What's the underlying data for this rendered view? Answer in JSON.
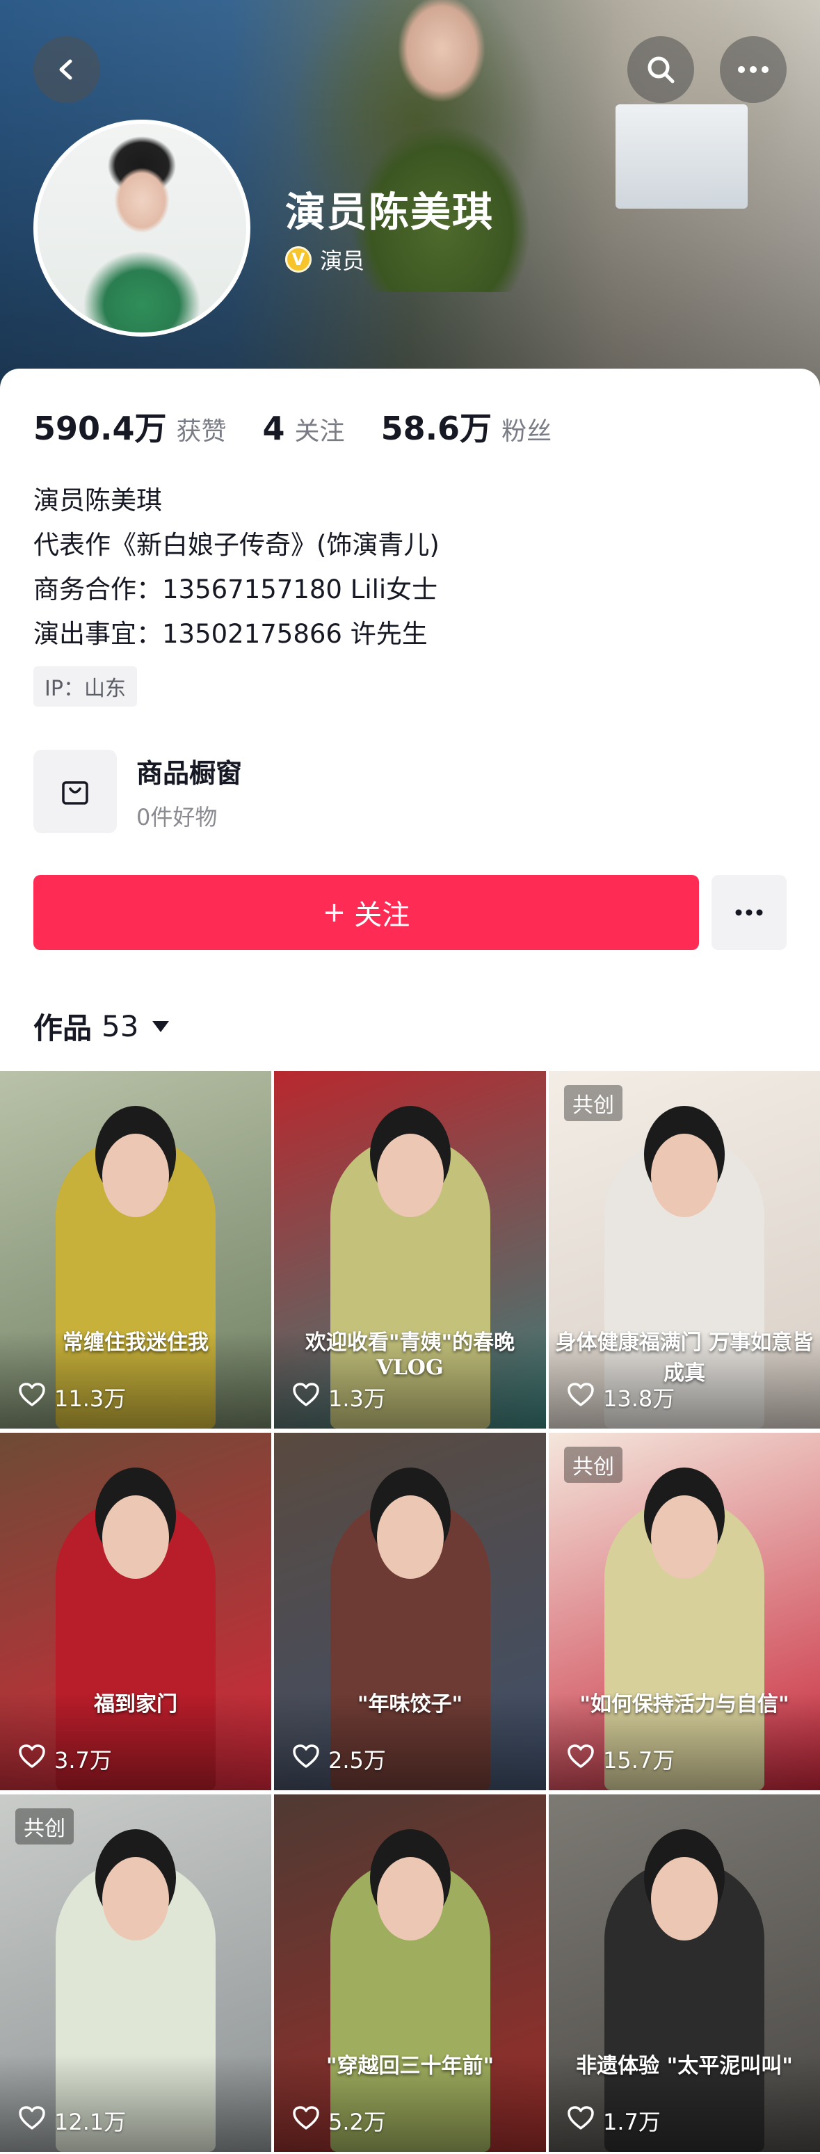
{
  "header": {
    "name": "演员陈美琪",
    "verified_badge": "V",
    "verified_label": "演员"
  },
  "stats": [
    {
      "value": "590.4万",
      "label": "获赞"
    },
    {
      "value": "4",
      "label": "关注"
    },
    {
      "value": "58.6万",
      "label": "粉丝"
    }
  ],
  "bio": {
    "lines": [
      "演员陈美琪",
      "代表作《新白娘子传奇》(饰演青儿)",
      "商务合作：13567157180 Lili女士",
      "演出事宜：13502175866 许先生"
    ],
    "ip": "IP：山东"
  },
  "shop": {
    "title": "商品橱窗",
    "subtitle": "0件好物"
  },
  "follow": {
    "label": "关注",
    "plus": "+"
  },
  "works": {
    "title": "作品",
    "count": "53"
  },
  "videos": [
    {
      "likes": "11.3万",
      "badge": "",
      "caption": "常缠住我迷住我",
      "colors": [
        "#b9c2a8",
        "#6f7f62"
      ],
      "outfit": "#c7b13a"
    },
    {
      "likes": "1.3万",
      "badge": "",
      "caption": "欢迎收看\"青姨\"的春晚VLOG",
      "colors": [
        "#b8282e",
        "#3a7f7a"
      ],
      "outfit": "#c3c17a"
    },
    {
      "likes": "13.8万",
      "badge": "共创",
      "caption": "身体健康福满门 万事如意皆成真",
      "colors": [
        "#f3ede6",
        "#d8cfc6"
      ],
      "outfit": "#e9e6e1"
    },
    {
      "likes": "3.7万",
      "badge": "",
      "caption": "福到家门",
      "colors": [
        "#6e4b36",
        "#d6273a"
      ],
      "outfit": "#b81d2a"
    },
    {
      "likes": "2.5万",
      "badge": "",
      "caption": "\"年味饺子\"",
      "colors": [
        "#5a4a3f",
        "#3e4f6a"
      ],
      "outfit": "#6e3b34"
    },
    {
      "likes": "15.7万",
      "badge": "共创",
      "caption": "\"如何保持活力与自信\"",
      "colors": [
        "#f4e6dc",
        "#c7263a"
      ],
      "outfit": "#d8d09b"
    },
    {
      "likes": "12.1万",
      "badge": "共创",
      "caption": "",
      "colors": [
        "#c9ccc9",
        "#8e9395"
      ],
      "outfit": "#dfe6d6"
    },
    {
      "likes": "5.2万",
      "badge": "",
      "caption": "\"穿越回三十年前\"",
      "colors": [
        "#4f3a33",
        "#9b2d2a"
      ],
      "outfit": "#9fae5e"
    },
    {
      "likes": "1.7万",
      "badge": "",
      "caption": "非遗体验 \"太平泥叫叫\"",
      "colors": [
        "#7d7a74",
        "#4a4845"
      ],
      "outfit": "#2c2c2c"
    }
  ]
}
